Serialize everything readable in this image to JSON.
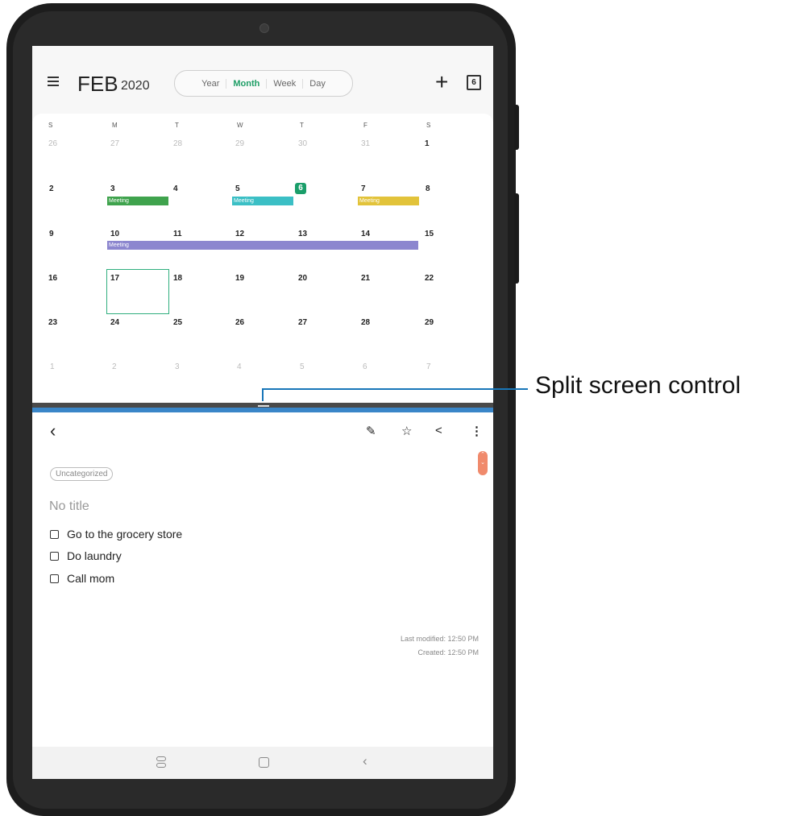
{
  "calendar": {
    "month": "FEB",
    "year": "2020",
    "view_tabs": [
      "Year",
      "Month",
      "Week",
      "Day"
    ],
    "active_tab": "Month",
    "add_icon": "plus-icon",
    "today_icon_label": "6",
    "weekdays": [
      "S",
      "M",
      "T",
      "W",
      "T",
      "F",
      "S"
    ],
    "weeks": [
      [
        "26",
        "27",
        "28",
        "29",
        "30",
        "31",
        "1"
      ],
      [
        "2",
        "3",
        "4",
        "5",
        "6",
        "7",
        "8"
      ],
      [
        "9",
        "10",
        "11",
        "12",
        "13",
        "14",
        "15"
      ],
      [
        "16",
        "17",
        "18",
        "19",
        "20",
        "21",
        "22"
      ],
      [
        "23",
        "24",
        "25",
        "26",
        "27",
        "28",
        "29"
      ],
      [
        "1",
        "2",
        "3",
        "4",
        "5",
        "6",
        "7"
      ]
    ],
    "events": [
      {
        "label": "Meeting",
        "color": "#3fa34d"
      },
      {
        "label": "Meeting",
        "color": "#3bbfc5"
      },
      {
        "label": "Meeting",
        "color": "#e2c33a"
      },
      {
        "label": "Meeting",
        "color": "#8c86cf"
      }
    ],
    "today": "6",
    "selected": "17"
  },
  "notes": {
    "tag": "Uncategorized",
    "title": "No title",
    "checklist": [
      "Go to the grocery store",
      "Do laundry",
      "Call mom"
    ],
    "last_modified": "Last modified: 12:50 PM",
    "created": "Created: 12:50 PM",
    "toolbar_icons": [
      "back-icon",
      "pen-icon",
      "star-icon",
      "share-icon",
      "more-icon"
    ]
  },
  "callout": {
    "label": "Split screen control"
  },
  "colors": {
    "accent": "#1a9e6a",
    "divider_blue": "#3a86c8"
  }
}
